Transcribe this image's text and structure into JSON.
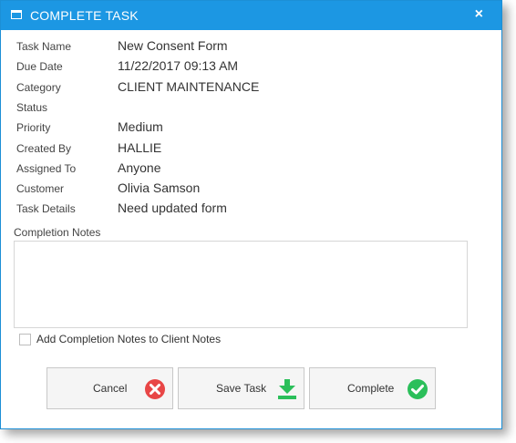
{
  "dialog": {
    "title": "COMPLETE TASK",
    "close_glyph": "×",
    "accent_color": "#1c97e3"
  },
  "fields": [
    {
      "label": "Task Name",
      "value": "New Consent Form"
    },
    {
      "label": "Due Date",
      "value": "11/22/2017 09:13 AM"
    },
    {
      "label": "Category",
      "value": "CLIENT MAINTENANCE"
    },
    {
      "label": "Status",
      "value": ""
    },
    {
      "label": "Priority",
      "value": "Medium"
    },
    {
      "label": "Created By",
      "value": "HALLIE"
    },
    {
      "label": "Assigned To",
      "value": "Anyone"
    },
    {
      "label": "Customer",
      "value": "Olivia Samson"
    },
    {
      "label": "Task Details",
      "value": "Need updated form"
    }
  ],
  "completion_notes": {
    "label": "Completion Notes",
    "value": ""
  },
  "add_to_client_notes": {
    "label": "Add Completion Notes to Client Notes",
    "checked": false
  },
  "buttons": {
    "cancel": {
      "label": "Cancel",
      "icon": "cancel-x-icon",
      "color": "#e84646"
    },
    "save": {
      "label": "Save Task",
      "icon": "download-arrow-icon",
      "color": "#2bbf5a"
    },
    "complete": {
      "label": "Complete",
      "icon": "checkmark-circle-icon",
      "color": "#2bbf5a"
    }
  }
}
